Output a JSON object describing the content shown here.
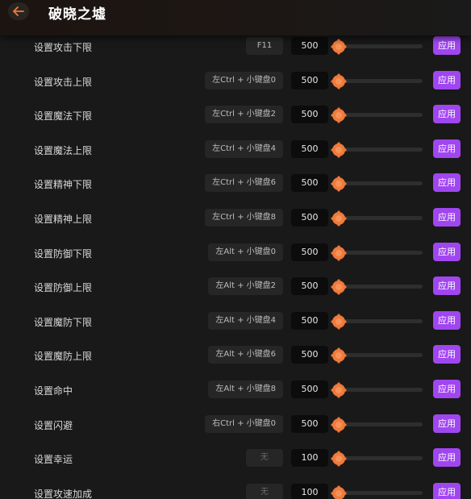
{
  "header": {
    "title": "破晓之墟"
  },
  "rows": [
    {
      "label": "设置攻击下限",
      "hotkey": "F11",
      "value": "500",
      "apply": "应用"
    },
    {
      "label": "设置攻击上限",
      "hotkey": "左Ctrl + 小键盘0",
      "value": "500",
      "apply": "应用"
    },
    {
      "label": "设置魔法下限",
      "hotkey": "左Ctrl + 小键盘2",
      "value": "500",
      "apply": "应用"
    },
    {
      "label": "设置魔法上限",
      "hotkey": "左Ctrl + 小键盘4",
      "value": "500",
      "apply": "应用"
    },
    {
      "label": "设置精神下限",
      "hotkey": "左Ctrl + 小键盘6",
      "value": "500",
      "apply": "应用"
    },
    {
      "label": "设置精神上限",
      "hotkey": "左Ctrl + 小键盘8",
      "value": "500",
      "apply": "应用"
    },
    {
      "label": "设置防御下限",
      "hotkey": "左Alt + 小键盘0",
      "value": "500",
      "apply": "应用"
    },
    {
      "label": "设置防御上限",
      "hotkey": "左Alt + 小键盘2",
      "value": "500",
      "apply": "应用"
    },
    {
      "label": "设置魔防下限",
      "hotkey": "左Alt + 小键盘4",
      "value": "500",
      "apply": "应用"
    },
    {
      "label": "设置魔防上限",
      "hotkey": "左Alt + 小键盘6",
      "value": "500",
      "apply": "应用"
    },
    {
      "label": "设置命中",
      "hotkey": "左Alt + 小键盘8",
      "value": "500",
      "apply": "应用"
    },
    {
      "label": "设置闪避",
      "hotkey": "右Ctrl + 小键盘0",
      "value": "500",
      "apply": "应用"
    },
    {
      "label": "设置幸运",
      "hotkey": "无",
      "value": "100",
      "apply": "应用"
    },
    {
      "label": "设置攻速加成",
      "hotkey": "无",
      "value": "100",
      "apply": "应用"
    }
  ],
  "colors": {
    "accent": "#a046f0",
    "thumb": "#f07a3a",
    "background": "#191919"
  },
  "icons": {
    "back": "arrow-left-icon",
    "thumb": "gear-thumb-icon"
  }
}
